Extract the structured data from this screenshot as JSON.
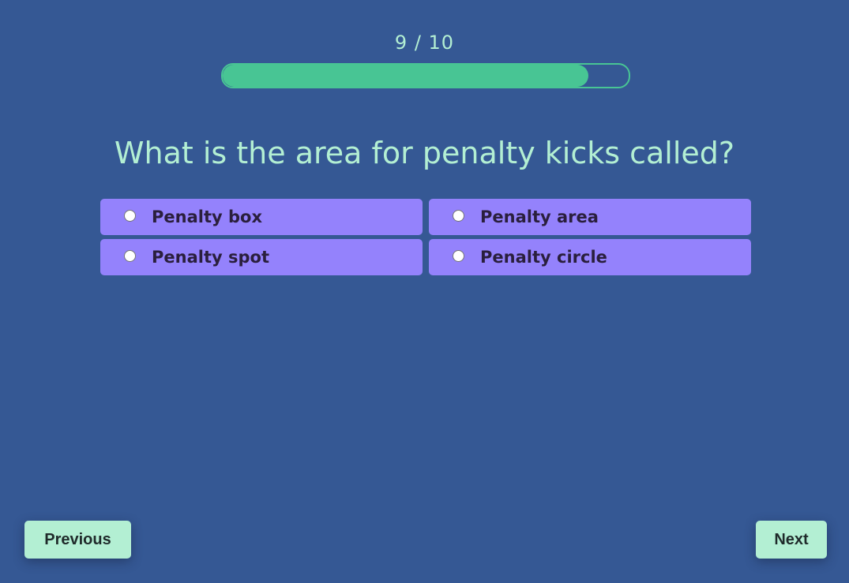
{
  "progress": {
    "current": 9,
    "total": 10,
    "label": "9 / 10",
    "fill_fraction": 0.9,
    "track_color": "#48c594",
    "fill_color": "#48c594"
  },
  "question": {
    "text": "What is the area for penalty kicks called?"
  },
  "options": [
    {
      "label": "Penalty box",
      "selected": false
    },
    {
      "label": "Penalty area",
      "selected": false
    },
    {
      "label": "Penalty spot",
      "selected": false
    },
    {
      "label": "Penalty circle",
      "selected": false
    }
  ],
  "navigation": {
    "previous_label": "Previous",
    "next_label": "Next"
  },
  "colors": {
    "background": "#355894",
    "text_accent": "#b3efd3",
    "option_background": "#9482fc",
    "button_background": "#b3efd3"
  }
}
